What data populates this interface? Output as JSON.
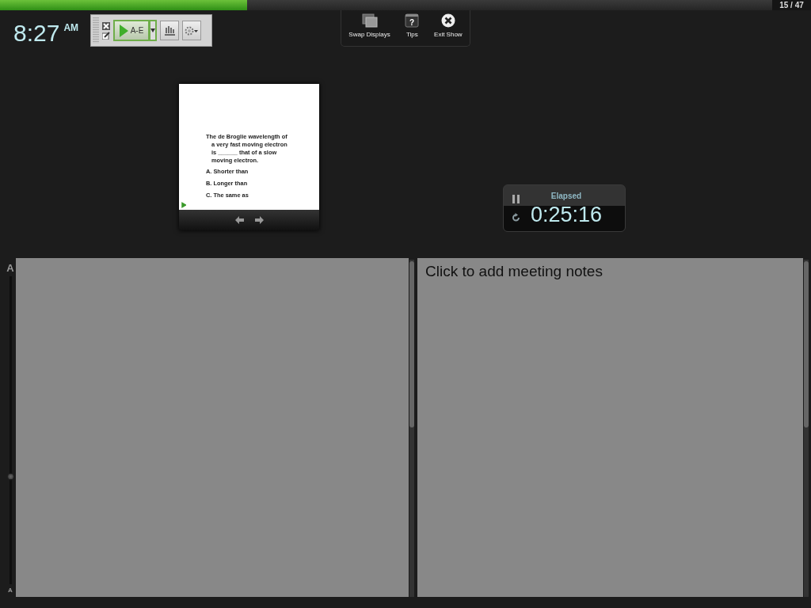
{
  "progress": {
    "level": 0.32,
    "counter": "15 / 47"
  },
  "clock": {
    "time": "8:27",
    "ampm": "AM"
  },
  "toolbar": {
    "play_label": "A-E"
  },
  "display_controls": [
    {
      "kind": "swap",
      "label": "Swap Displays"
    },
    {
      "kind": "tips",
      "label": "Tips",
      "glyph": "?"
    },
    {
      "kind": "exit",
      "label": "Exit Show"
    }
  ],
  "slide": {
    "question": "The de Broglie wavelength of a very fast moving electron is ______ that of a slow moving electron.",
    "options": [
      "A. Shorter than",
      "B. Longer than",
      "C. The same as"
    ]
  },
  "timer": {
    "label": "Elapsed",
    "time": "0:25:16"
  },
  "font_size": {
    "level": 0.35,
    "large_label": "A",
    "small_label": "A"
  },
  "notes": {
    "placeholder": "Click to add meeting notes"
  }
}
